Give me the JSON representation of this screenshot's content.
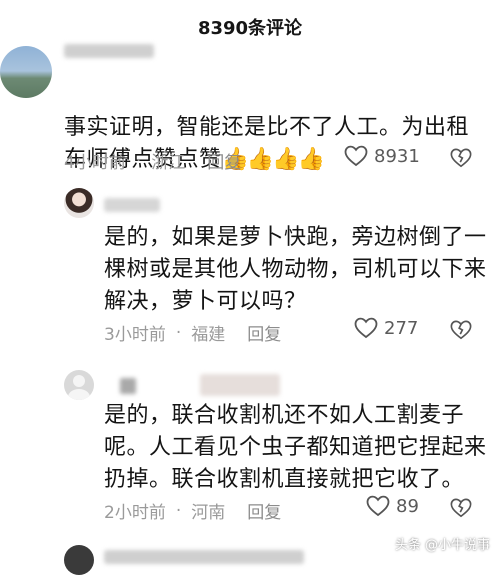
{
  "header": {
    "title": "8390条评论"
  },
  "comments": [
    {
      "text": "事实证明，智能还是比不了人工。为出租\n车师傅点赞点赞",
      "thumbs": "👍👍👍👍",
      "time": "4小时前",
      "location": "浙江",
      "reply": "回复",
      "likes": "8931"
    },
    {
      "text": "是的，如果是萝卜快跑，旁边树倒了一\n棵树或是其他人物动物，司机可以下来\n解决，萝卜可以吗？",
      "time": "3小时前",
      "location": "福建",
      "reply": "回复",
      "likes": "277"
    },
    {
      "text": "是的，联合收割机还不如人工割麦子\n呢。人工看见个虫子都知道把它捏起来\n扔掉。联合收割机直接就把它收了。",
      "time": "2小时前",
      "location": "河南",
      "reply": "回复",
      "likes": "89"
    }
  ],
  "icons": {
    "like": "heart-outline-icon",
    "dislike": "broken-heart-outline-icon"
  },
  "watermark": "头条 @小牛说事"
}
